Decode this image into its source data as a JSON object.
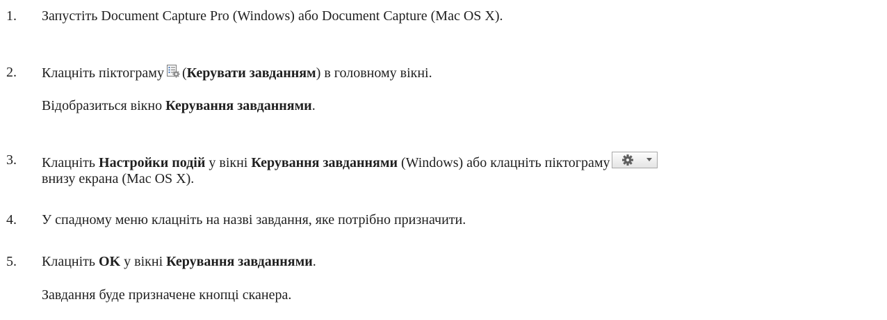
{
  "steps": [
    {
      "number": "1.",
      "text": "Запустіть Document Capture Pro (Windows) або Document Capture (Mac OS X)."
    },
    {
      "number": "2.",
      "pre": "Клацніть піктограму",
      "paren_open": "(",
      "bold": "Керувати завданням",
      "post": ") в головному вікні.",
      "result_pre": "Відобразиться вікно ",
      "result_bold": "Керування завданнями",
      "result_post": "."
    },
    {
      "number": "3.",
      "pre": "Клацніть ",
      "bold1": "Настройки подій",
      "mid": " у вікні ",
      "bold2": "Керування завданнями",
      "post": " (Windows) або клацніть піктограму",
      "line2": "внизу екрана (Mac OS X)."
    },
    {
      "number": "4.",
      "text": "У спадному меню клацніть на назві завдання, яке потрібно призначити."
    },
    {
      "number": "5.",
      "pre": "Клацніть ",
      "bold1": "OK",
      "mid": " у вікні ",
      "bold2": "Керування завданнями",
      "post": ".",
      "result": "Завдання буде призначене кнопці сканера."
    }
  ],
  "icons": {
    "manage_task": "manage-task-icon",
    "gear_menu": "gear-menu-button-icon"
  }
}
